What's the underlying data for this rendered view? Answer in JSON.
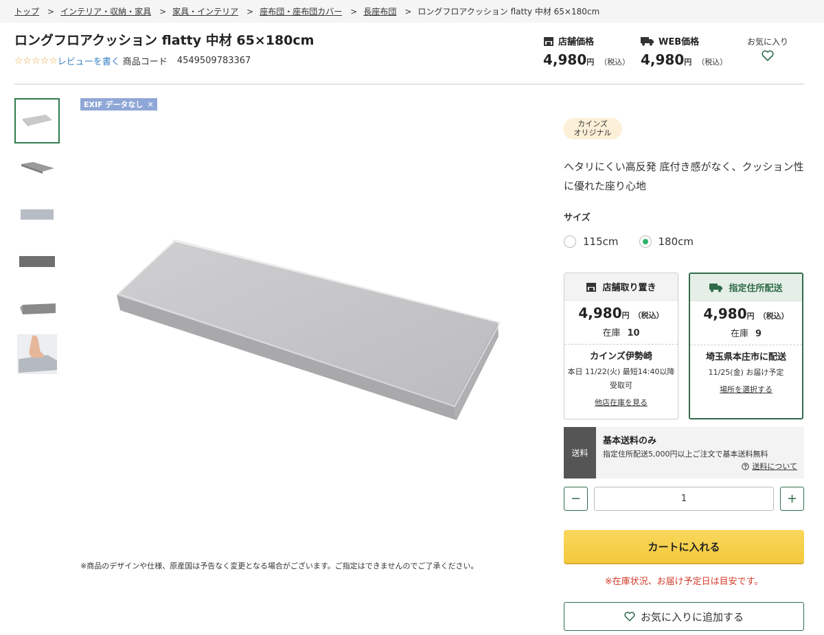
{
  "breadcrumb": [
    "トップ",
    "インテリア・収納・家具",
    "家具・インテリア",
    "座布団・座布団カバー",
    "長座布団"
  ],
  "breadcrumb_current": "ロングフロアクッション flatty 中材 65×180cm",
  "product": {
    "title": "ロングフロアクッション flatty 中材 65×180cm",
    "stars": "☆☆☆☆☆",
    "review_link": "レビューを書く",
    "code_label": "商品コード",
    "code_value": "4549509783367"
  },
  "prices": {
    "store_label": "店舗価格",
    "store_value": "4,980",
    "web_label": "WEB価格",
    "web_value": "4,980",
    "yen": "円",
    "tax": "（税込）"
  },
  "favorite_top_label": "お気に入り",
  "exif_label": "EXIF データなし",
  "note": "※商品のデザインや仕様、原産国は予告なく変更となる場合がございます。ご指定はできませんのでご了承ください。",
  "badge": [
    "カインズ",
    "オリジナル"
  ],
  "description": "ヘタリにくい高反発 底付き感がなく、クッション性に優れた座り心地",
  "size": {
    "label": "サイズ",
    "options": [
      "115cm",
      "180cm"
    ],
    "selected": "180cm"
  },
  "delivery": {
    "store": {
      "head": "店舗取り置き",
      "price": "4,980",
      "yen": "円",
      "tax": "（税込）",
      "stock_label": "在庫",
      "stock": "10",
      "store_name": "カインズ伊勢崎",
      "sub": "本日 11/22(火) 最短14:40以降受取可",
      "link": "他店在庫を見る"
    },
    "home": {
      "head": "指定住所配送",
      "price": "4,980",
      "yen": "円",
      "tax": "（税込）",
      "stock_label": "在庫",
      "stock": "9",
      "store_name": "埼玉県本庄市に配送",
      "sub": "11/25(金) お届け予定",
      "link": "場所を選択する"
    }
  },
  "shipping": {
    "tag": "送料",
    "title": "基本送料のみ",
    "desc": "指定住所配送5,000円以上ご注文で基本送料無料",
    "link": "送料について"
  },
  "quantity": {
    "minus": "−",
    "value": "1",
    "plus": "+"
  },
  "cart_button": "カートに入れる",
  "stock_note": "※在庫状況、お届け予定日は目安です。",
  "fav_button": "お気に入りに追加する",
  "colors": {
    "green": "#2f6b48",
    "yellow": "#f9d85c",
    "red": "#d23a2a",
    "star": "#e8a33a"
  }
}
